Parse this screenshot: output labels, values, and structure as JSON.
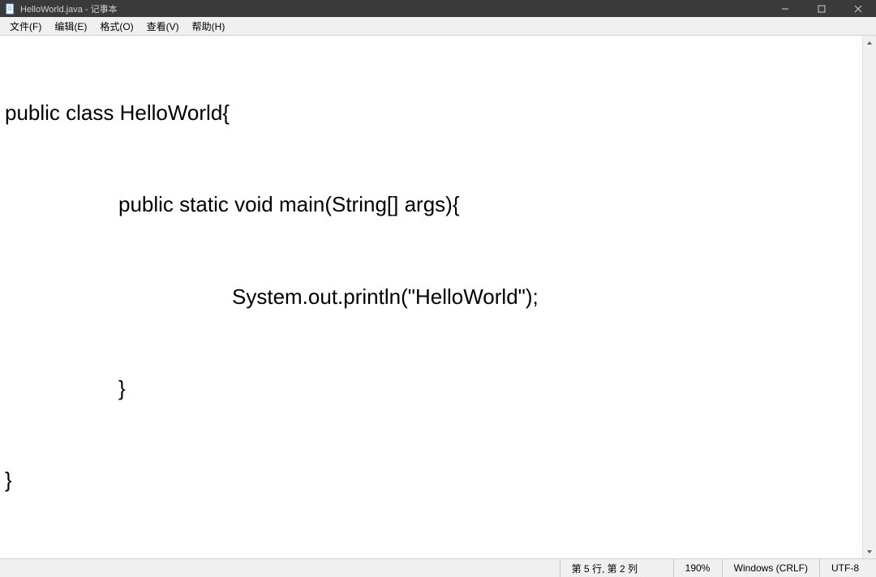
{
  "titlebar": {
    "title": "HelloWorld.java - 记事本"
  },
  "menubar": {
    "file": "文件(F)",
    "edit": "编辑(E)",
    "format": "格式(O)",
    "view": "查看(V)",
    "help": "帮助(H)"
  },
  "editor": {
    "lines": [
      "public class HelloWorld{",
      "public static void main(String[] args){",
      "System.out.println(\"HelloWorld\");",
      "}",
      "}"
    ]
  },
  "statusbar": {
    "position": "第 5 行, 第 2 列",
    "zoom": "190%",
    "line_ending": "Windows (CRLF)",
    "encoding": "UTF-8"
  }
}
